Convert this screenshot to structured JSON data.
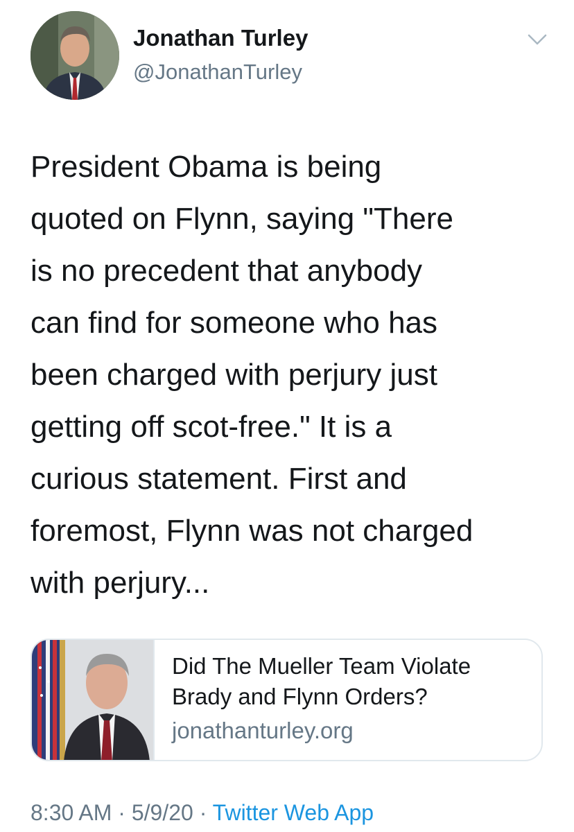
{
  "tweet": {
    "author": {
      "name": "Jonathan Turley",
      "handle": "@JonathanTurley"
    },
    "text_lines": [
      "President Obama is being",
      "quoted on Flynn, saying \"There",
      "is no precedent that anybody",
      "can find for someone who has",
      "been charged with perjury just",
      "getting off scot-free.\" It is a",
      "curious statement. First and",
      "foremost, Flynn was not charged",
      "with perjury..."
    ],
    "card": {
      "title_lines": [
        "Did The Mueller Team Violate",
        "Brady and Flynn Orders?"
      ],
      "domain": "jonathanturley.org"
    },
    "meta": {
      "time": "8:30 AM",
      "sep1": " · ",
      "date": "5/9/20",
      "sep2": " · ",
      "app": "Twitter Web App"
    }
  },
  "icons": {
    "menu": "chevron-down-icon"
  },
  "colors": {
    "text": "#14171a",
    "secondary": "#657786",
    "link": "#1b95e0",
    "border": "#e1e8ed"
  }
}
